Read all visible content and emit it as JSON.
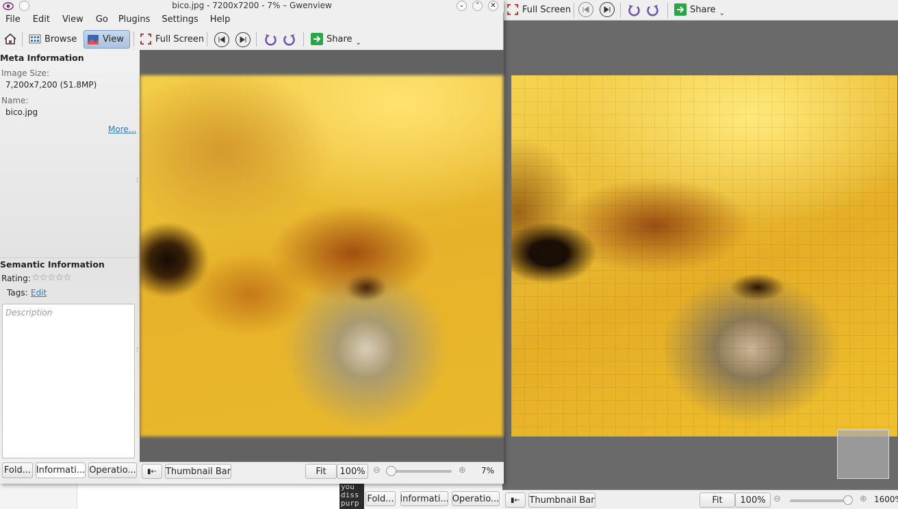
{
  "window": {
    "title": "bico.jpg - 7200x7200 - 7% – Gwenview"
  },
  "menu": [
    "File",
    "Edit",
    "View",
    "Go",
    "Plugins",
    "Settings",
    "Help"
  ],
  "toolbar": {
    "browse": "Browse",
    "view": "View",
    "fullscreen": "Full Screen",
    "share": "Share"
  },
  "sidebar": {
    "meta_heading": "Meta Information",
    "image_size_label": "Image Size:",
    "image_size_value": "7,200x7,200 (51.8MP)",
    "name_label": "Name:",
    "name_value": "bico.jpg",
    "more": "More...",
    "semantic_heading": "Semantic Information",
    "rating_label": "Rating:",
    "rating": 0,
    "tags_label": "Tags:",
    "tags_edit": "Edit",
    "description_placeholder": "Description",
    "tabs": [
      "Fold...",
      "Informati...",
      "Operatio..."
    ]
  },
  "statusbar": {
    "thumbnail": "Thumbnail Bar",
    "fit": "Fit",
    "p100": "100%",
    "zoom": "7%",
    "zoom_level": 0.03
  },
  "back_window": {
    "fullscreen": "Full Screen",
    "share": "Share",
    "tabs": [
      "Fold...",
      "Informati...",
      "Operatio..."
    ],
    "thumbnail": "Thumbnail Bar",
    "fit": "Fit",
    "p100": "100%",
    "zoom": "1600%",
    "zoom_level": 0.97,
    "terminal_lines": [
      "you",
      "diss",
      "purp"
    ]
  },
  "colors": {
    "accent": "#2a7ac7",
    "toolbar": "#efefef",
    "viewer": "#626262",
    "image_yellow": "#e8b326"
  }
}
